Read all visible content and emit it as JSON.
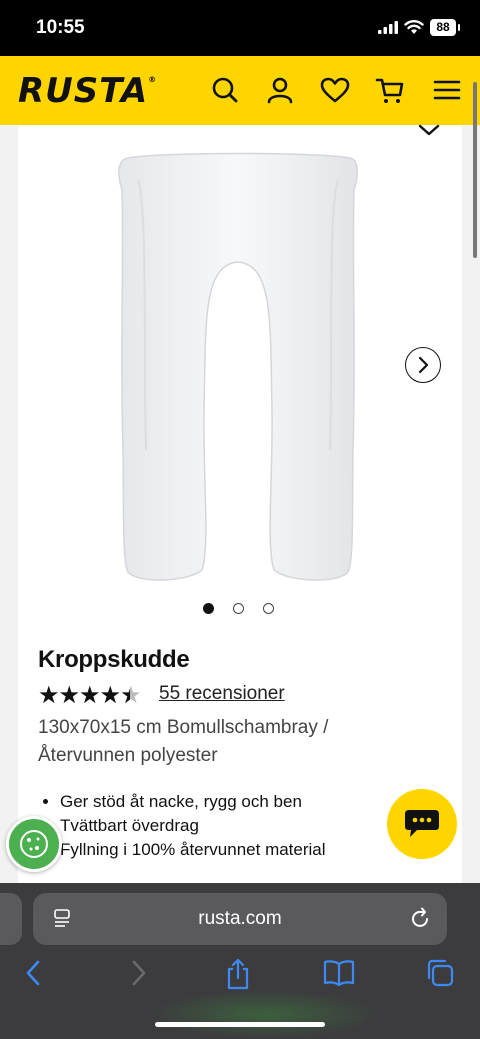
{
  "status_bar": {
    "time": "10:55",
    "battery": "88"
  },
  "header": {
    "logo": "RUSTA",
    "icons": [
      "search-icon",
      "account-icon",
      "heart-icon",
      "cart-icon",
      "menu-icon"
    ],
    "background": "#ffd500"
  },
  "gallery": {
    "image_count": 3,
    "active_index": 0
  },
  "product": {
    "title": "Kroppskudde",
    "rating": 4.5,
    "rating_max": 5,
    "stars_full": "★★★★★",
    "reviews_label": "55 recensioner",
    "description": "130x70x15 cm Bomullschambray / Återvunnen polyester",
    "features": [
      "Ger stöd åt nacke, rygg och ben",
      "Tvättbart överdrag",
      "Fyllning i 100% återvunnet material"
    ]
  },
  "browser": {
    "url": "rusta.com",
    "toolbar_icons": [
      "back-icon",
      "forward-icon",
      "share-icon",
      "bookmarks-icon",
      "tabs-icon"
    ],
    "accent": "#3d8af7"
  }
}
